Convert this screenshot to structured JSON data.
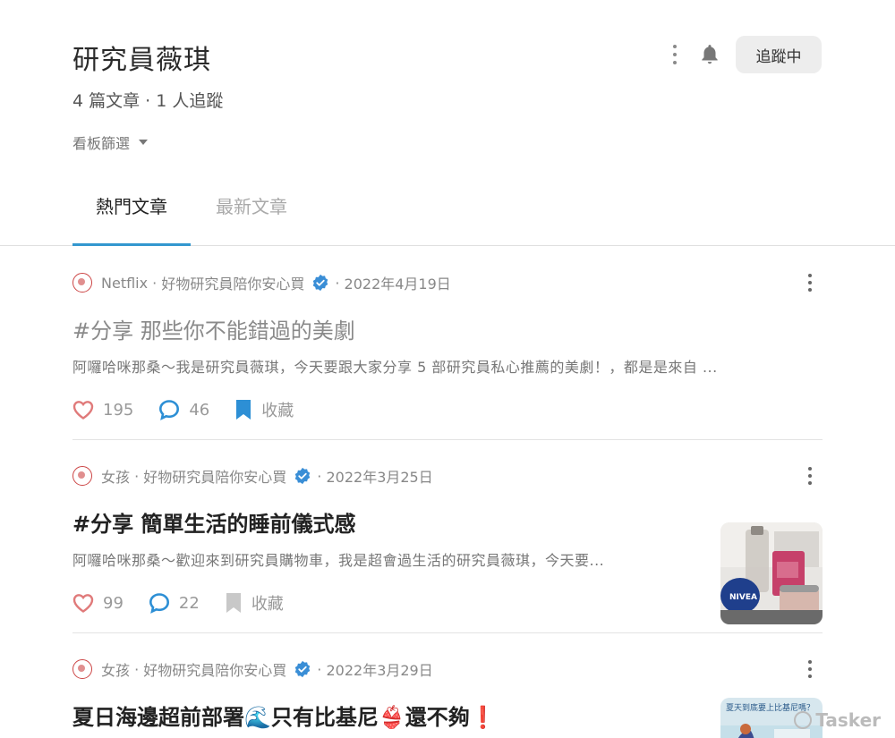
{
  "profile": {
    "name": "研究員薇琪",
    "stats": "4 篇文章 · 1 人追蹤",
    "filter_label": "看板篩選",
    "follow_label": "追蹤中"
  },
  "tabs": [
    {
      "label": "熱門文章",
      "active": true
    },
    {
      "label": "最新文章",
      "active": false
    }
  ],
  "posts": [
    {
      "board": "Netflix",
      "author": "好物研究員陪你安心買",
      "date": "2022年4月19日",
      "title": "#分享 那些你不能錯過的美劇",
      "excerpt": "阿囉哈咪那桑～我是研究員薇琪，今天要跟大家分享 5 部研究員私心推薦的美劇！，都是是來自 ...",
      "likes": "195",
      "comments": "46",
      "save_label": "收藏",
      "saved": true,
      "read": true
    },
    {
      "board": "女孩",
      "author": "好物研究員陪你安心買",
      "date": "2022年3月25日",
      "title": "#分享 簡單生活的睡前儀式感",
      "excerpt": "阿囉哈咪那桑～歡迎來到研究員購物車，我是超會過生活的研究員薇琪，今天要...",
      "likes": "99",
      "comments": "22",
      "save_label": "收藏",
      "saved": false,
      "read": false
    },
    {
      "board": "女孩",
      "author": "好物研究員陪你安心買",
      "date": "2022年3月29日",
      "title": "夏日海邊超前部署🌊只有比基尼👙還不夠❗",
      "read": false
    }
  ],
  "thumb_card_text": "夏天到底要上比基尼嗎？",
  "watermark": "Tasker",
  "colors": {
    "accent": "#3397cf",
    "heart": "#e07a7a",
    "comment": "#2d8fd5",
    "bookmark_saved": "#2d8fd5",
    "bookmark_unsaved": "#c8c8c8"
  }
}
